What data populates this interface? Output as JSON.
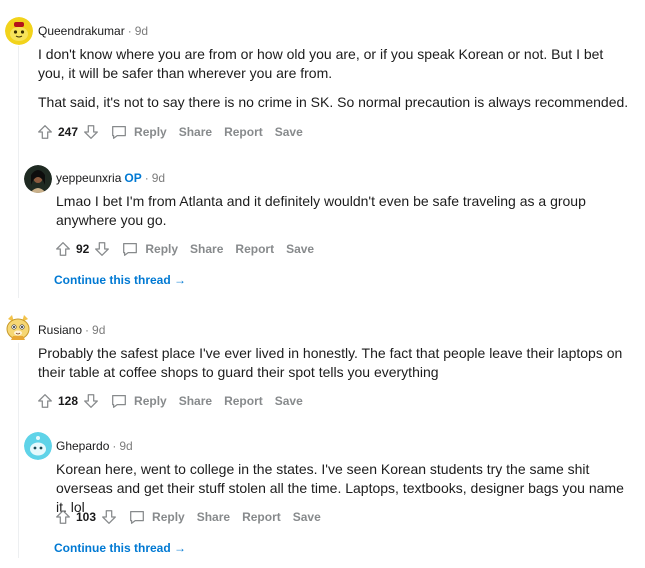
{
  "actions": {
    "reply": "Reply",
    "share": "Share",
    "report": "Report",
    "save": "Save"
  },
  "comments": [
    {
      "author": "Queendrakumar",
      "age": "9d",
      "paragraphs": [
        "I don't know where you are from or how old you are, or if you speak Korean or not. But I bet you, it will be safer than wherever you are from.",
        "That said, it's not to say there is no crime in SK. So normal precaution is always recommended."
      ],
      "score": "247"
    },
    {
      "author": "yeppeunxria",
      "op_label": "OP",
      "age": "9d",
      "paragraphs": [
        "Lmao I bet I'm from Atlanta and it definitely wouldn't even be safe traveling as a group anywhere you go."
      ],
      "score": "92",
      "continue_label": "Continue this thread"
    },
    {
      "author": "Rusiano",
      "age": "9d",
      "paragraphs": [
        "Probably the safest place I've ever lived in honestly. The fact that people leave their laptops on their table at coffee shops to guard their spot tells you everything"
      ],
      "score": "128"
    },
    {
      "author": "Ghepardo",
      "age": "9d",
      "paragraphs": [
        "Korean here, went to college in the states. I've seen Korean students try the same shit overseas and get their stuff stolen all the time. Laptops, textbooks, designer bags you name it. lol"
      ],
      "score": "103",
      "continue_label": "Continue this thread"
    }
  ]
}
